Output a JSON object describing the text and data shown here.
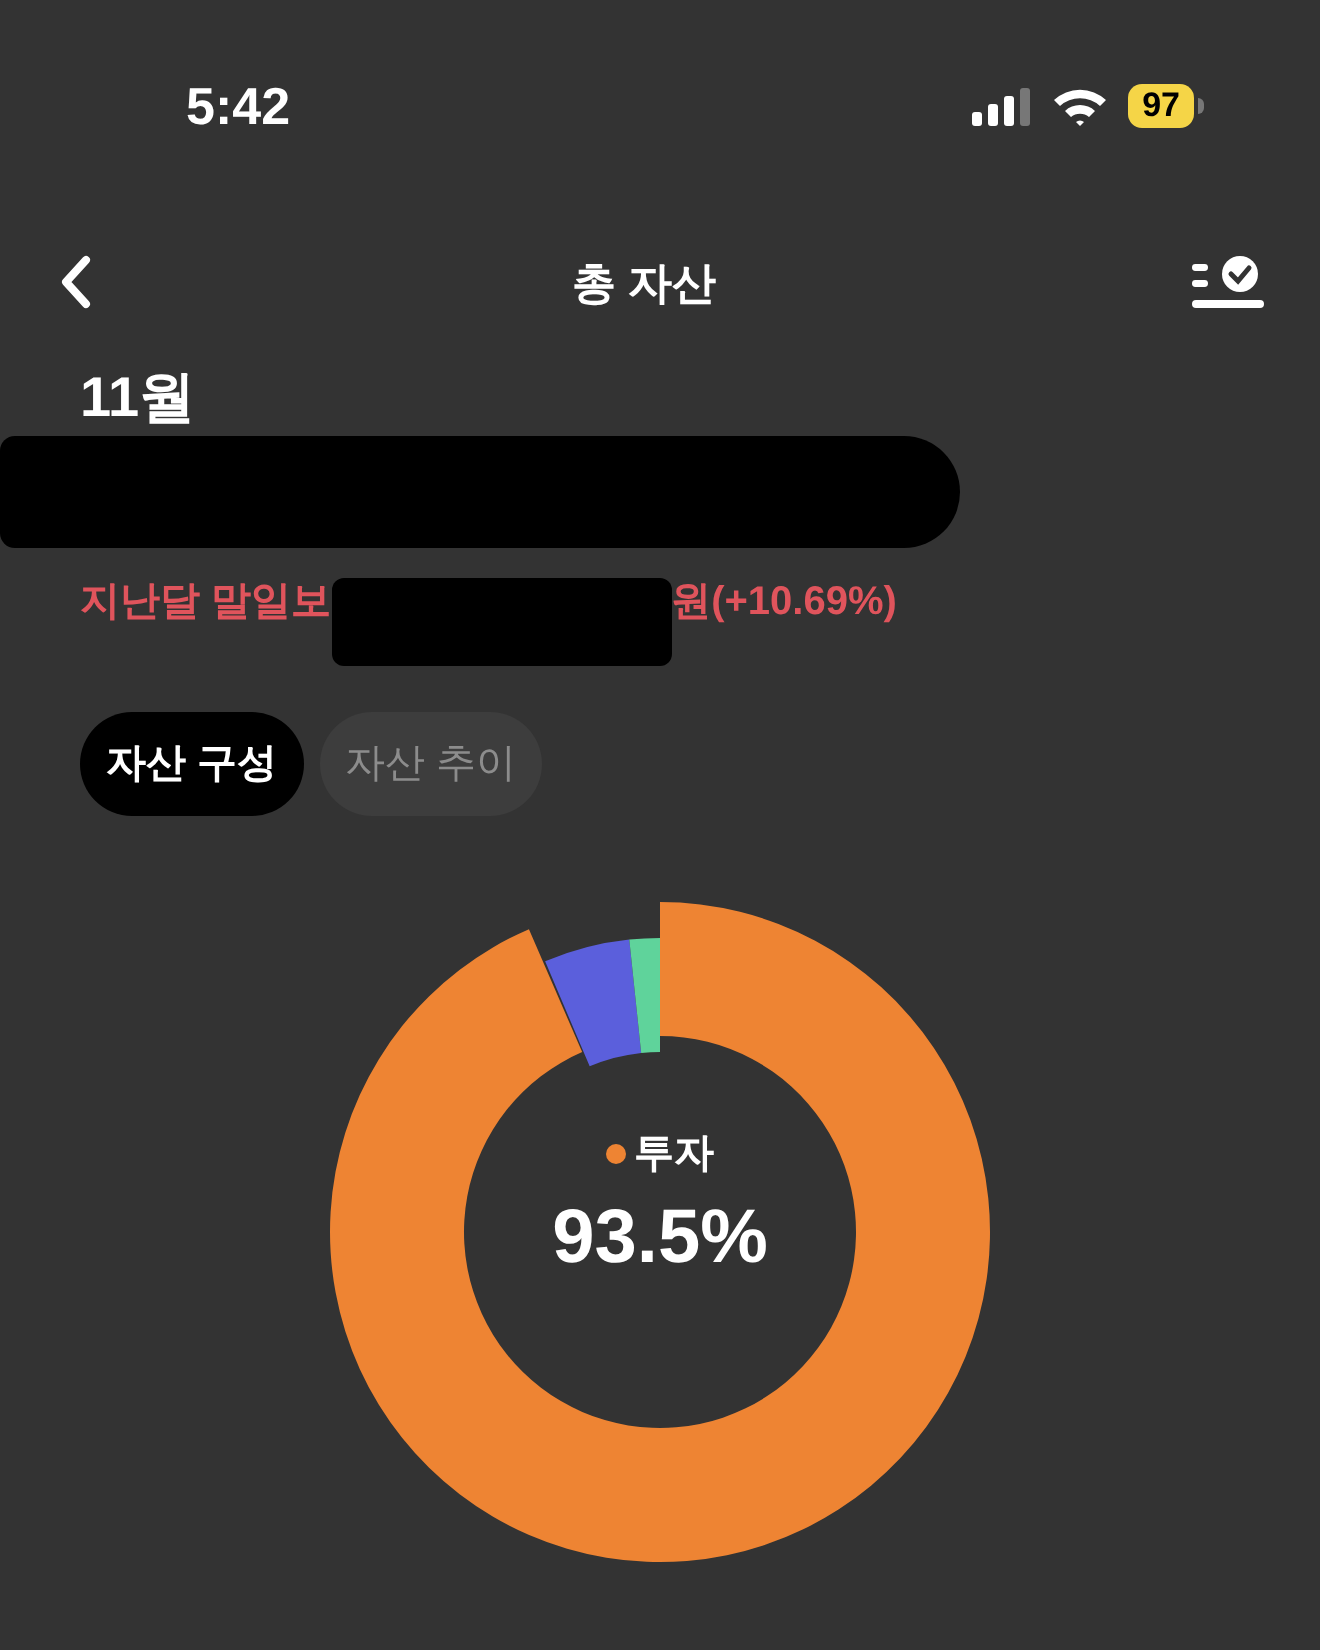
{
  "status_bar": {
    "time": "5:42",
    "battery": "97"
  },
  "nav": {
    "title": "총 자산"
  },
  "month": "11월",
  "change": {
    "before_mark": "지난달 말일보",
    "after_mark": "원(+10.69%)"
  },
  "tabs": [
    {
      "label": "자산 구성",
      "selected": true
    },
    {
      "label": "자산 추이",
      "selected": false
    }
  ],
  "donut": {
    "label": "투자",
    "value": "93.5%",
    "color": "#ee8433"
  }
}
